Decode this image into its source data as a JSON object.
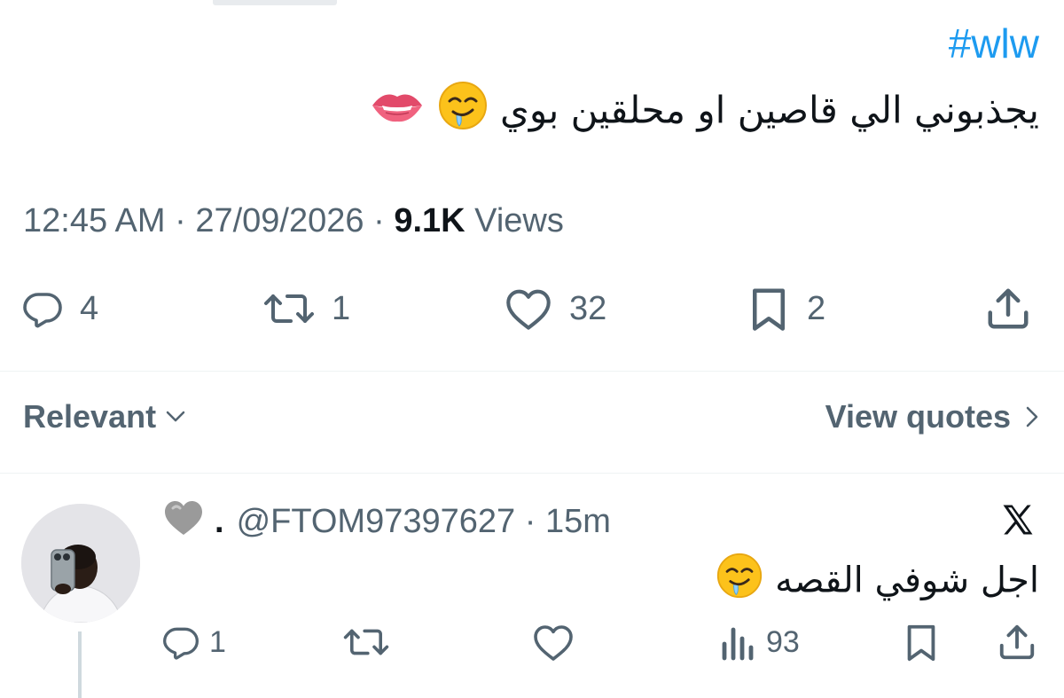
{
  "tweet": {
    "hashtag": "#wlw",
    "text": "يجذبوني الي قاصين  او محلقين بوي",
    "emojis": [
      "drooling-face",
      "biting-lip"
    ],
    "time": "12:45 AM",
    "date": "27/09/2026",
    "views_count": "9.1K",
    "views_label": "Views",
    "actions": {
      "replies": "4",
      "reposts": "1",
      "likes": "32",
      "bookmarks": "2"
    }
  },
  "sort": {
    "relevant_label": "Relevant",
    "view_quotes_label": "View quotes"
  },
  "reply": {
    "display_name": ".",
    "name_emoji": "grey-heart",
    "handle": "@FTOM97397627",
    "age": "15m",
    "text": "اجل شوفي القصه",
    "emoji": "drooling-face",
    "actions": {
      "replies": "1",
      "views": "93"
    }
  },
  "colors": {
    "accent": "#1d9bf0",
    "text": "#0f1419",
    "secondary": "#536471",
    "divider": "#eff3f4"
  }
}
